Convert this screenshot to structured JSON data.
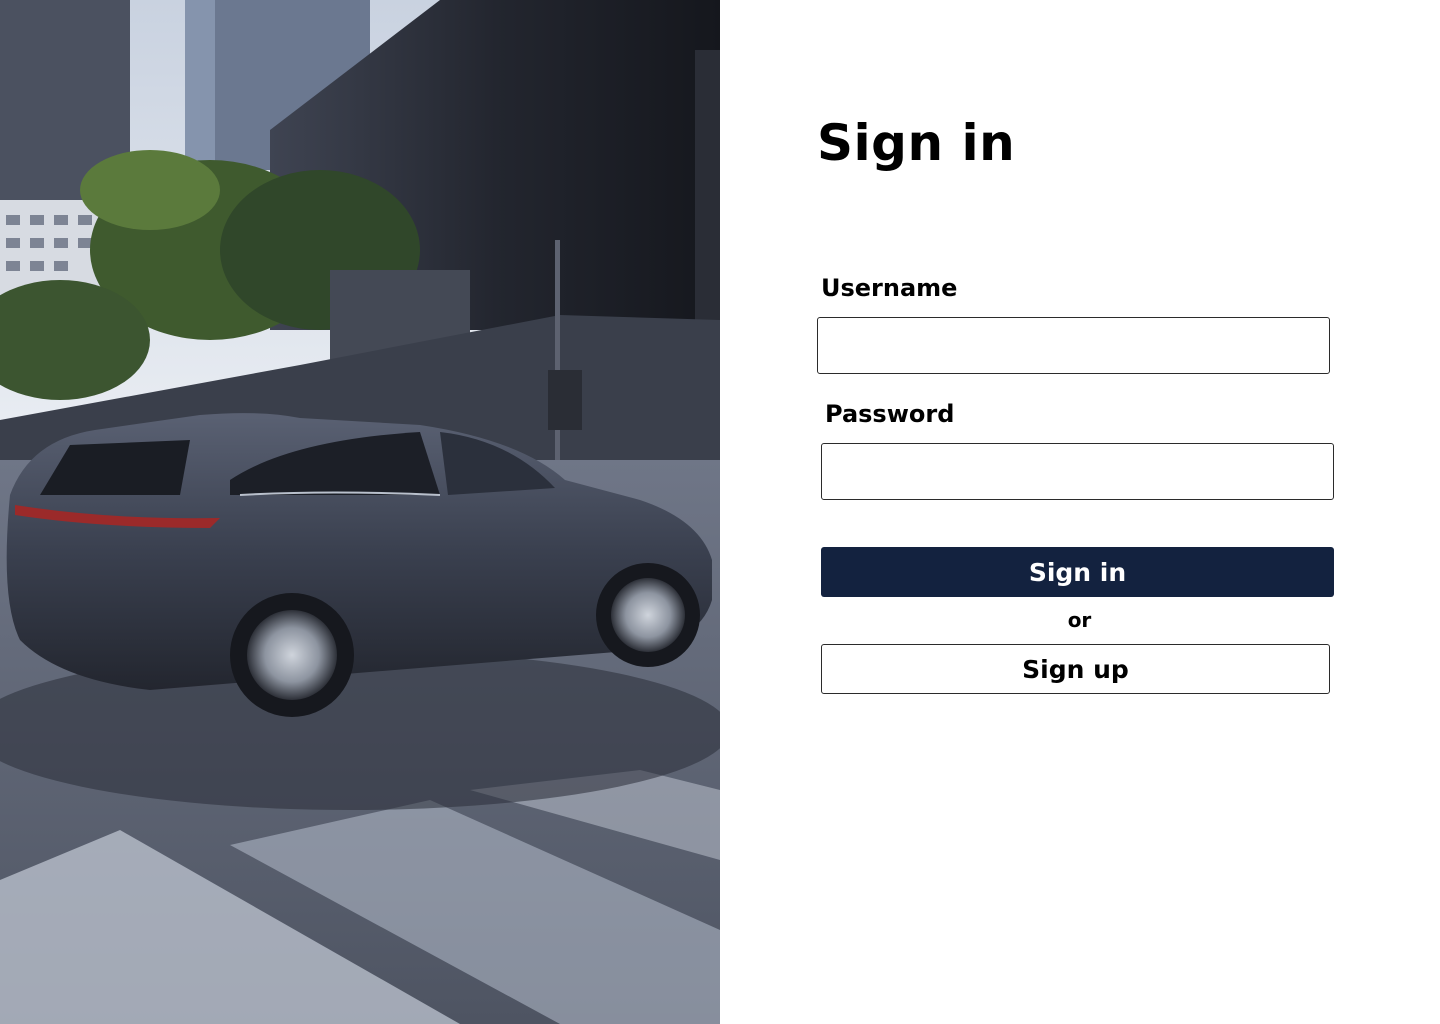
{
  "hero": {
    "image_subject": "dark grey SUV driving on a city street in front of modern buildings"
  },
  "signin_form": {
    "title": "Sign in",
    "username_label": "Username",
    "username_value": "",
    "password_label": "Password",
    "password_value": "",
    "submit_label": "Sign in",
    "divider_text": "or",
    "signup_label": "Sign up"
  },
  "colors": {
    "primary_button": "#13223f",
    "field_border": "#2b2b2b",
    "background": "#ffffff"
  }
}
